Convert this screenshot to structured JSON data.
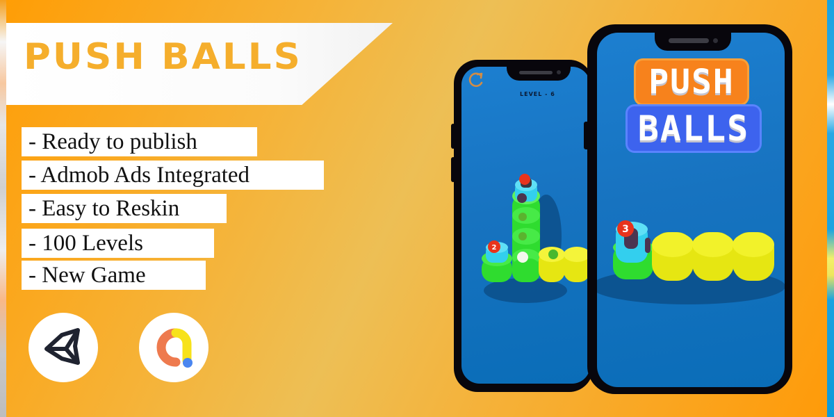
{
  "promo": {
    "title": "PUSH BALLS",
    "title_color": "#f5ae2c",
    "features": [
      "- Ready to publish",
      "- Admob Ads Integrated",
      "- Easy to Reskin",
      "- 100 Levels",
      "- New Game"
    ],
    "logos": [
      {
        "name": "unity-logo-icon",
        "label": "Unity"
      },
      {
        "name": "admob-logo-icon",
        "label": "AdMob"
      }
    ]
  },
  "phones": {
    "gameplay": {
      "level_label": "LEVEL - 6",
      "restart_icon": "restart-icon",
      "ball_numbers": [
        "2"
      ]
    },
    "title_screen": {
      "title_line1": "PUSH",
      "title_line2": "BALLS",
      "ball_numbers": [
        "3"
      ]
    }
  },
  "colors": {
    "background_orange": "#ff9d05",
    "background_light": "#edbf55",
    "screen_blue": "#1773c0",
    "green_tube": "#36e83a",
    "yellow_tube": "#f2f21e",
    "cyan_tube": "#33cfee",
    "red_ball": "#e8331c"
  }
}
